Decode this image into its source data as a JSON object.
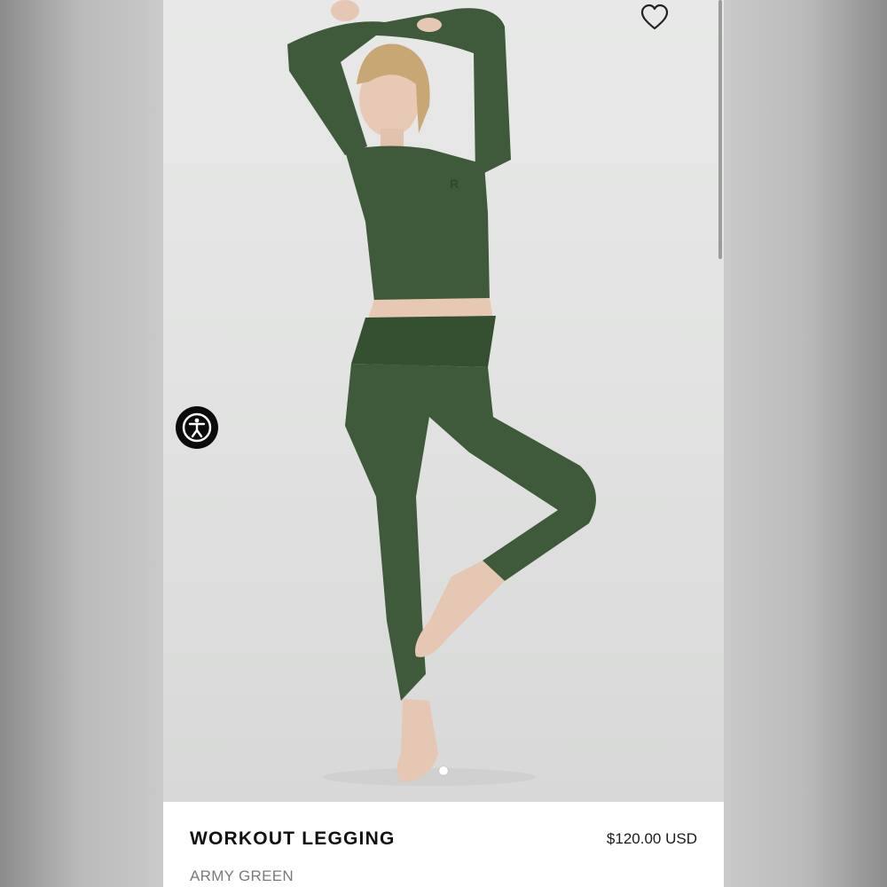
{
  "product": {
    "title": "WORKOUT LEGGING",
    "price": "$120.00 USD",
    "color_name": "ARMY GREEN"
  },
  "gallery": {
    "image_alt": "Model wearing army green long-sleeve crop top and workout legging",
    "current_slide": 1,
    "total_slides": 1
  },
  "icons": {
    "wishlist": "heart-icon",
    "accessibility": "accessibility-icon"
  },
  "colors": {
    "garment": "#3f5a3a",
    "backdrop": "#e2e3e2"
  }
}
